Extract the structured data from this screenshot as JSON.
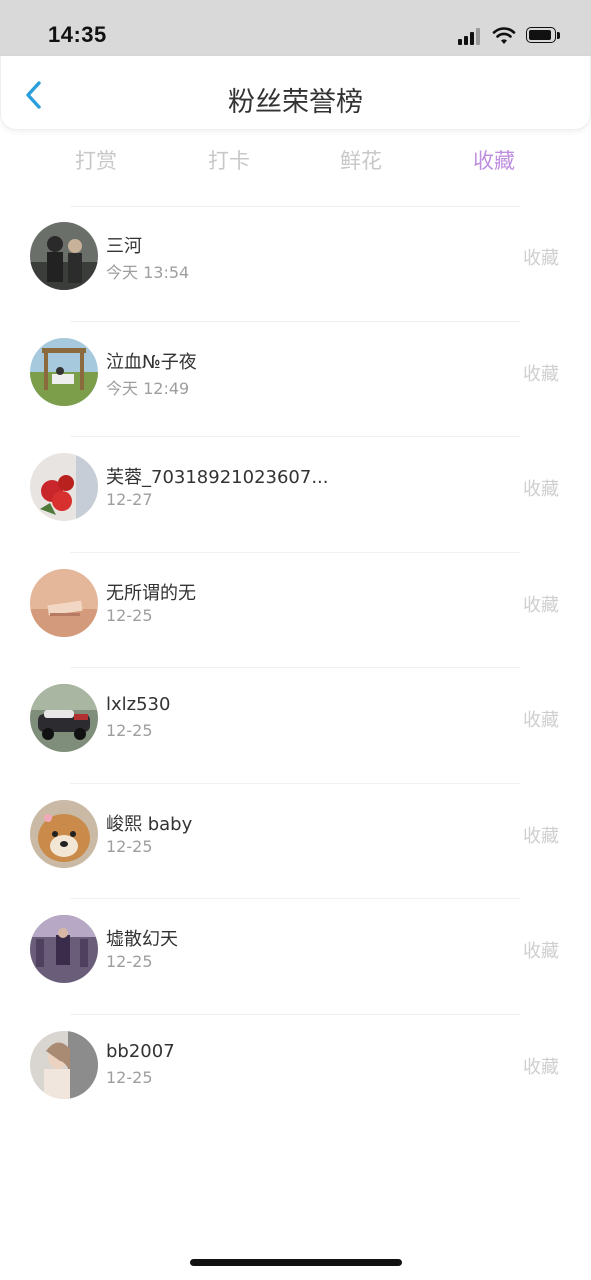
{
  "status_bar": {
    "time": "14:35"
  },
  "header": {
    "title": "粉丝荣誉榜"
  },
  "tabs": [
    {
      "label": "打赏",
      "active": false
    },
    {
      "label": "打卡",
      "active": false
    },
    {
      "label": "鲜花",
      "active": false
    },
    {
      "label": "收藏",
      "active": true
    }
  ],
  "fans": [
    {
      "name": "三河",
      "time": "今天 13:54",
      "action": "收藏"
    },
    {
      "name": "泣血№子夜",
      "time": "今天 12:49",
      "action": "收藏"
    },
    {
      "name": "芙蓉_70318921023607...",
      "time": "12-27",
      "action": "收藏"
    },
    {
      "name": "无所谓的无",
      "time": "12-25",
      "action": "收藏"
    },
    {
      "name": "lxlz530",
      "time": "12-25",
      "action": "收藏"
    },
    {
      "name": "峻熙 baby",
      "time": "12-25",
      "action": "收藏"
    },
    {
      "name": "墟散幻天",
      "time": "12-25",
      "action": "收藏"
    },
    {
      "name": "bb2007",
      "time": "12-25",
      "action": "收藏"
    }
  ],
  "colors": {
    "accent": "#bf8fe0",
    "back": "#2a9fdc",
    "inactive_tab": "#c8c8c8"
  },
  "icons": {
    "back": "chevron-left-icon",
    "signal": "cellular-signal-icon",
    "wifi": "wifi-icon",
    "battery": "battery-icon"
  }
}
